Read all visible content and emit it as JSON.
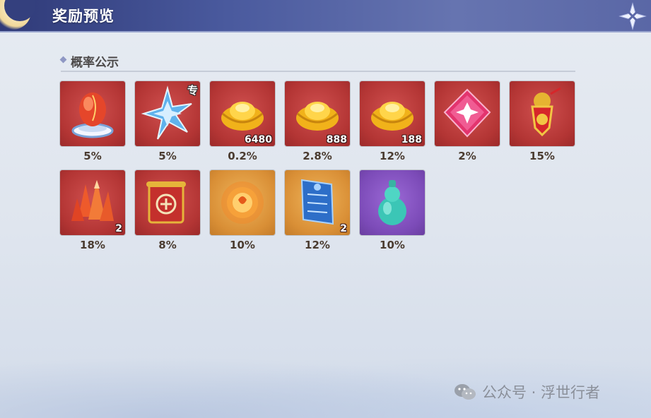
{
  "header": {
    "title": "奖励预览"
  },
  "section": {
    "title": "概率公示"
  },
  "items": [
    {
      "icon": "red-egg-icon",
      "bg": "red",
      "prob": "5%",
      "count": "",
      "tag": ""
    },
    {
      "icon": "blue-star-crystal-icon",
      "bg": "red",
      "prob": "5%",
      "count": "",
      "tag": "专"
    },
    {
      "icon": "gold-ingot-icon",
      "bg": "red",
      "prob": "0.2%",
      "count": "6480",
      "tag": ""
    },
    {
      "icon": "gold-ingot-icon",
      "bg": "red",
      "prob": "2.8%",
      "count": "888",
      "tag": ""
    },
    {
      "icon": "gold-ingot-icon",
      "bg": "red",
      "prob": "12%",
      "count": "188",
      "tag": ""
    },
    {
      "icon": "pink-gem-icon",
      "bg": "red",
      "prob": "2%",
      "count": "",
      "tag": ""
    },
    {
      "icon": "red-charm-icon",
      "bg": "red",
      "prob": "15%",
      "count": "",
      "tag": ""
    },
    {
      "icon": "fire-crystal-icon",
      "bg": "red",
      "prob": "18%",
      "count": "2",
      "tag": ""
    },
    {
      "icon": "red-scroll-icon",
      "bg": "red",
      "prob": "8%",
      "count": "",
      "tag": ""
    },
    {
      "icon": "fire-orb-icon",
      "bg": "gold",
      "prob": "10%",
      "count": "",
      "tag": ""
    },
    {
      "icon": "blue-talisman-icon",
      "bg": "gold",
      "prob": "12%",
      "count": "2",
      "tag": ""
    },
    {
      "icon": "jade-gourd-icon",
      "bg": "purple",
      "prob": "10%",
      "count": "",
      "tag": ""
    }
  ],
  "watermark": {
    "text": "公众号 · 浮世行者"
  }
}
